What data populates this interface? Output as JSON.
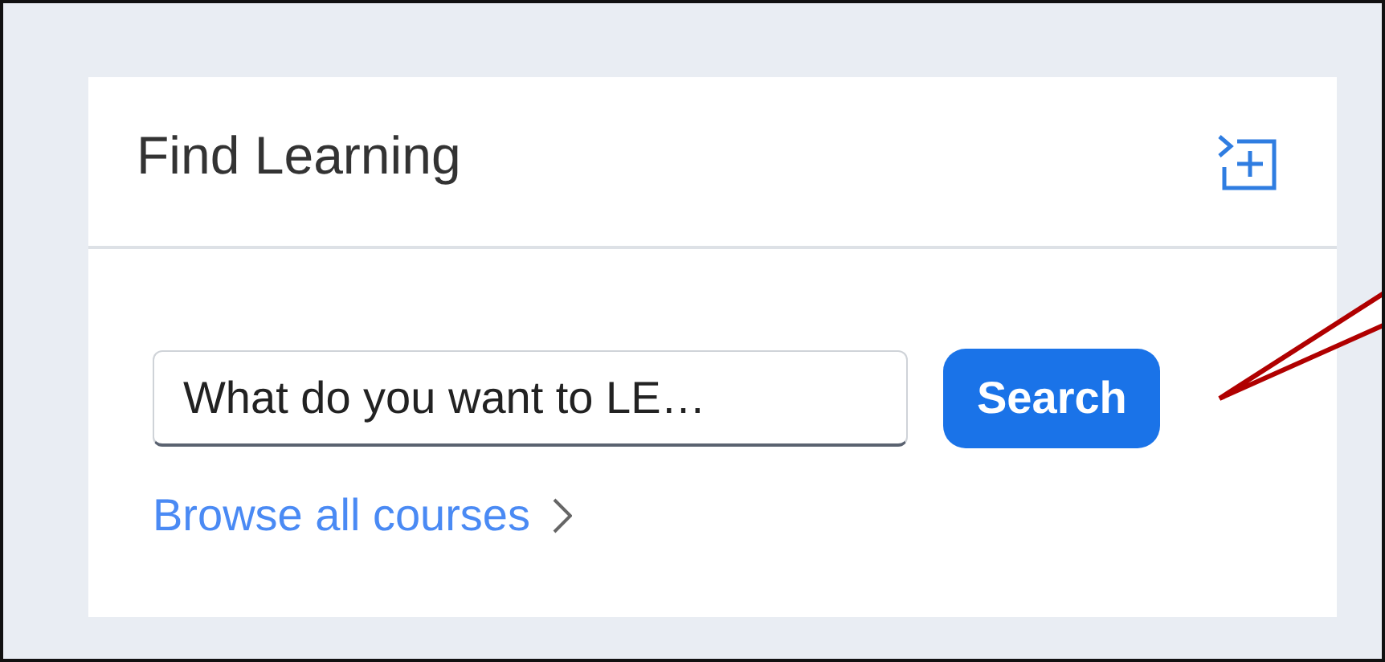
{
  "card": {
    "title": "Find Learning"
  },
  "search": {
    "placeholder": "What do you want to LE…",
    "button": "Search"
  },
  "browse_link": "Browse all courses"
}
